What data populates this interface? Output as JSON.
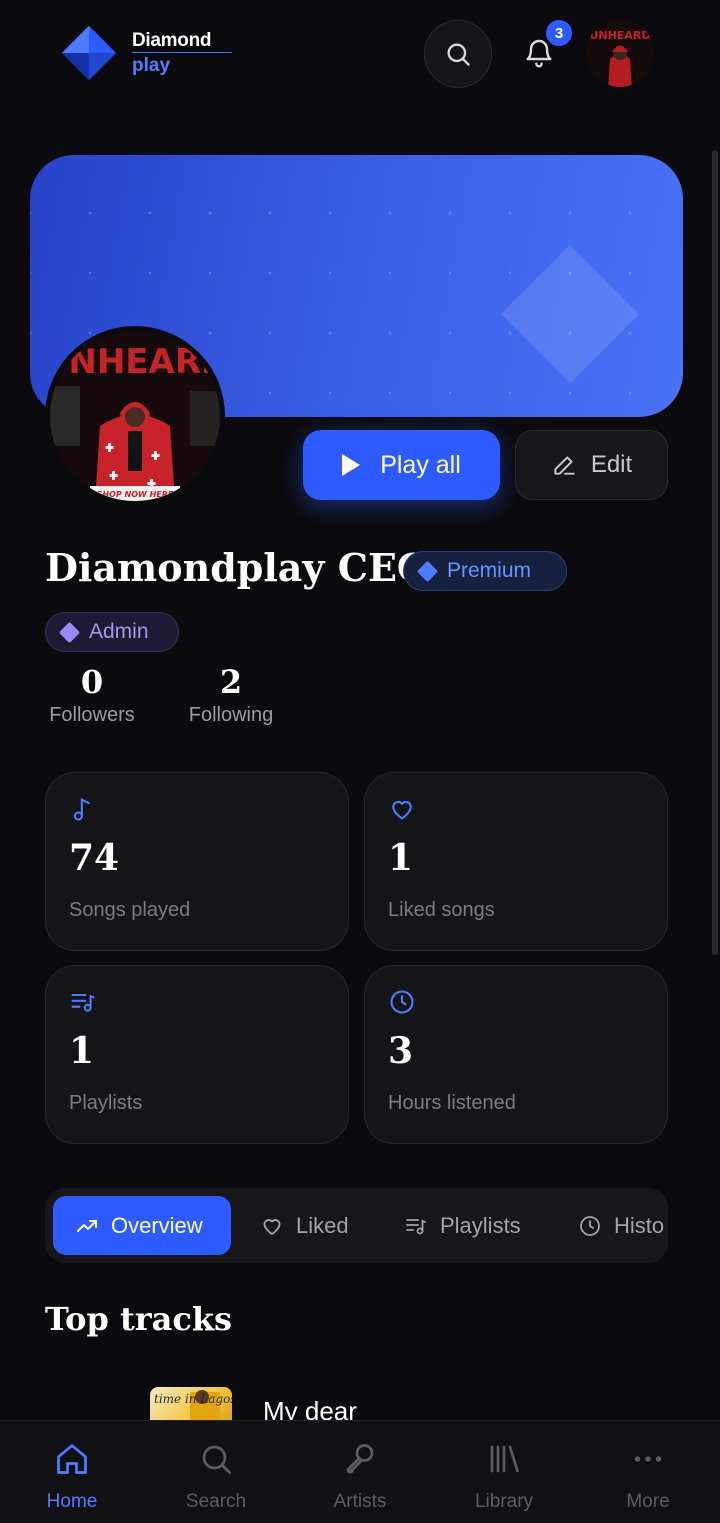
{
  "brand": {
    "line1": "Diamond",
    "line2": "play"
  },
  "header": {
    "notification_count": "3"
  },
  "profile": {
    "name": "Diamondplay CEO",
    "premium_badge": "Premium",
    "admin_badge": "Admin",
    "followers": {
      "count": "0",
      "label": "Followers"
    },
    "following": {
      "count": "2",
      "label": "Following"
    }
  },
  "actions": {
    "play_all": "Play all",
    "edit": "Edit"
  },
  "stats": [
    {
      "icon": "music-note-icon",
      "value": "74",
      "label": "Songs played"
    },
    {
      "icon": "heart-icon",
      "value": "1",
      "label": "Liked songs"
    },
    {
      "icon": "playlist-icon",
      "value": "1",
      "label": "Playlists"
    },
    {
      "icon": "clock-icon",
      "value": "3",
      "label": "Hours listened"
    }
  ],
  "tabs": [
    {
      "label": "Overview",
      "active": true
    },
    {
      "label": "Liked"
    },
    {
      "label": "Playlists"
    },
    {
      "label": "Histo"
    }
  ],
  "sections": {
    "top_tracks_title": "Top tracks"
  },
  "top_tracks": [
    {
      "title": "My dear",
      "cover_text": "time in Lagos"
    }
  ],
  "bottom_nav": [
    {
      "label": "Home",
      "active": true
    },
    {
      "label": "Search"
    },
    {
      "label": "Artists"
    },
    {
      "label": "Library"
    },
    {
      "label": "More"
    }
  ],
  "avatar_art_text": "UNHEARD",
  "avatar_caption": "SHOP NOW HERE",
  "colors": {
    "accent": "#2d5bff",
    "background": "#0b0b0f",
    "card": "#141419",
    "premium": "#6a92ff",
    "admin": "#a695f0"
  }
}
